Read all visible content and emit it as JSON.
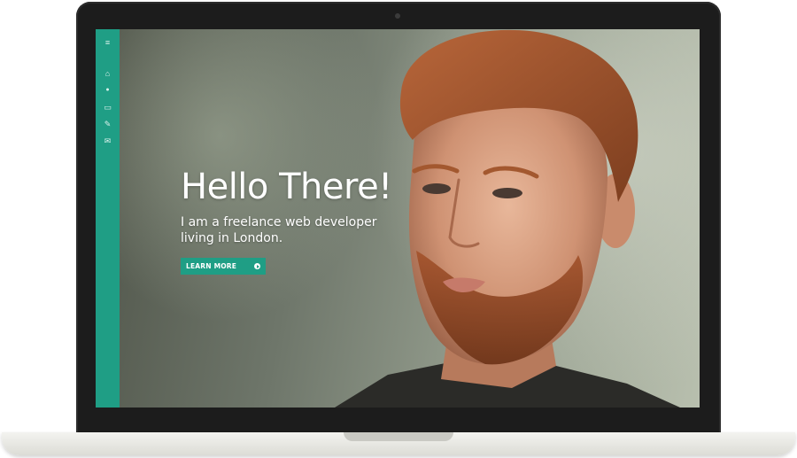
{
  "sidebar": {
    "color": "#1f9e85",
    "items": [
      {
        "icon": "menu-icon",
        "glyph": "≡"
      },
      {
        "icon": "home-icon",
        "glyph": "⌂"
      },
      {
        "icon": "user-icon",
        "glyph": "●"
      },
      {
        "icon": "laptop-icon",
        "glyph": "▭"
      },
      {
        "icon": "pencil-icon",
        "glyph": "✎"
      },
      {
        "icon": "envelope-icon",
        "glyph": "✉"
      }
    ]
  },
  "hero": {
    "title": "Hello There!",
    "subtitle": "I am a freelance web developer living in London.",
    "button_label": "LEARN MORE",
    "button_icon": "arrow-right-circle-icon",
    "accent": "#1f9e85"
  }
}
